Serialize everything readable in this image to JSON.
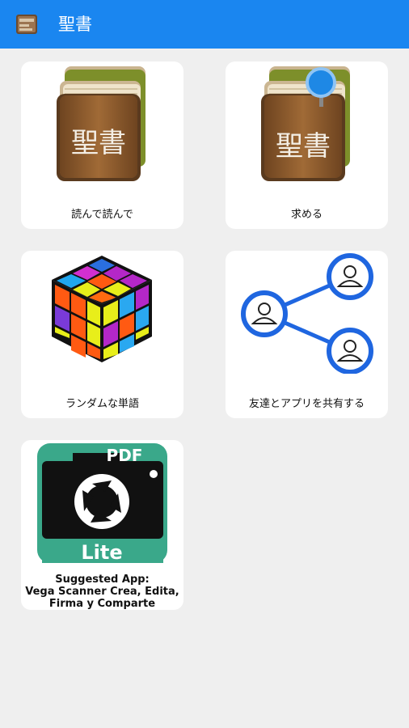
{
  "appbar": {
    "title": "聖書",
    "icon": "bible-app-icon",
    "color": "#1a86f0"
  },
  "menu": [
    {
      "id": "read",
      "label": "読んで読んで",
      "icon": "bible-book-icon",
      "book_title": "聖書"
    },
    {
      "id": "search",
      "label": "求める",
      "icon": "bible-search-icon",
      "book_title": "聖書"
    },
    {
      "id": "random",
      "label": "ランダムな単語",
      "icon": "rubik-cube-icon"
    },
    {
      "id": "share",
      "label": "友達とアプリを共有する",
      "icon": "share-network-icon"
    },
    {
      "id": "suggested",
      "label_lines": [
        "Suggested App:",
        "Vega Scanner Crea, Edita,",
        "Firma y Comparte"
      ],
      "icon": "pdf-scanner-lite-icon",
      "badge_top": "PDF",
      "badge_bottom": "Lite",
      "badge_color": "#3aa88a"
    }
  ]
}
